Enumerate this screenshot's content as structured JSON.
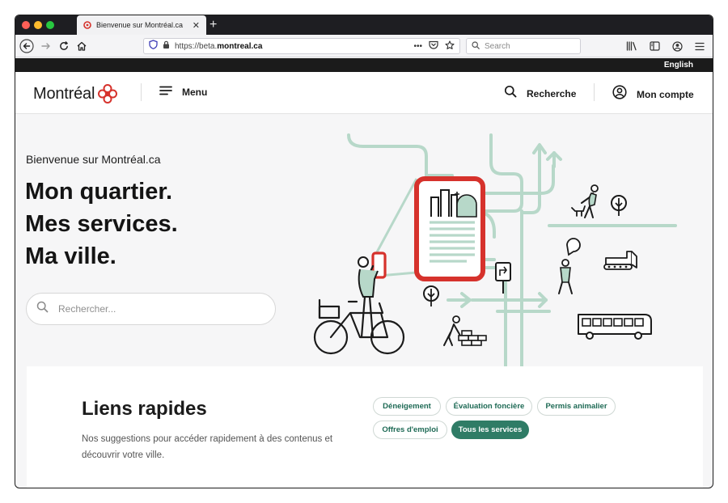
{
  "browser": {
    "tab_title": "Bienvenue sur Montréal.ca",
    "tab_close": "✕",
    "new_tab": "+",
    "url_prefix": "https://beta.",
    "url_domain": "montreal.ca",
    "url_more": "•••",
    "search_placeholder": "Search"
  },
  "topbar": {
    "language": "English"
  },
  "header": {
    "logo_text": "Montréal",
    "menu_label": "Menu",
    "search_label": "Recherche",
    "account_label": "Mon compte"
  },
  "hero": {
    "welcome": "Bienvenue sur Montréal.ca",
    "headline_1": "Mon quartier.",
    "headline_2": "Mes services.",
    "headline_3": "Ma ville.",
    "search_placeholder": "Rechercher..."
  },
  "quick_links": {
    "title": "Liens rapides",
    "description": "Nos suggestions pour accéder rapidement à des contenus et découvrir votre ville.",
    "chips": [
      "Déneigement",
      "Évaluation foncière",
      "Permis animalier",
      "Offres d'emploi",
      "Tous les services"
    ]
  },
  "colors": {
    "accent": "#2f7c66",
    "brand_red": "#d6322c",
    "illus_green": "#b7d8c9",
    "dark": "#1b1b1b"
  },
  "icons": [
    "back-arrow-icon",
    "forward-arrow-icon",
    "reload-icon",
    "home-icon",
    "shield-icon",
    "lock-icon",
    "pocket-icon",
    "star-icon",
    "search-icon",
    "library-icon",
    "sidebar-icon",
    "account-icon",
    "hamburger-icon",
    "user-icon"
  ]
}
